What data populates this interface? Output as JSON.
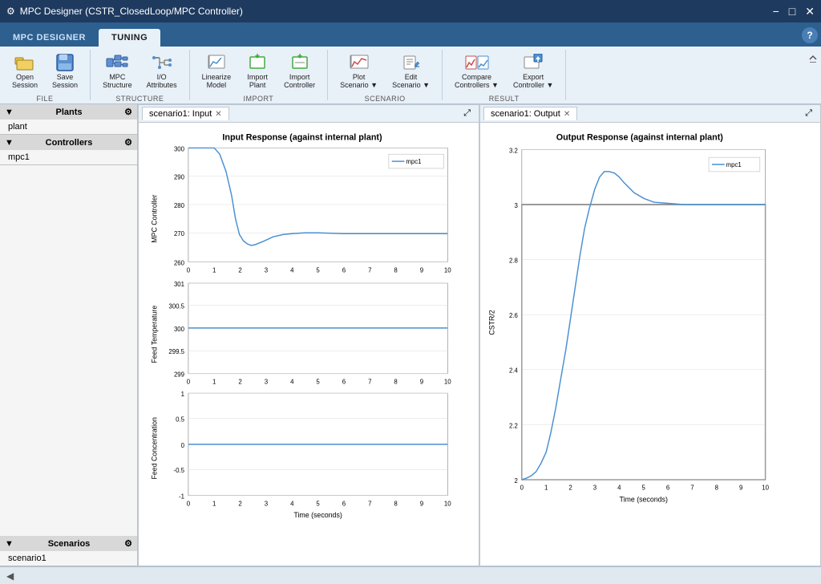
{
  "titlebar": {
    "title": "MPC Designer (CSTR_ClosedLoop/MPC Controller)",
    "icon": "⚙",
    "controls": [
      "−",
      "□",
      "✕"
    ]
  },
  "tabs": [
    {
      "id": "mpc-designer",
      "label": "MPC DESIGNER",
      "active": false
    },
    {
      "id": "tuning",
      "label": "TUNING",
      "active": true
    }
  ],
  "toolbar": {
    "groups": [
      {
        "id": "file",
        "label": "FILE",
        "items": [
          {
            "id": "open-session",
            "icon": "📂",
            "label": "Open\nSession"
          },
          {
            "id": "save-session",
            "icon": "💾",
            "label": "Save\nSession"
          }
        ]
      },
      {
        "id": "structure",
        "label": "STRUCTURE",
        "items": [
          {
            "id": "mpc-structure",
            "icon": "🔧",
            "label": "MPC\nStructure"
          },
          {
            "id": "io-attributes",
            "icon": "⚙",
            "label": "I/O\nAttributes"
          }
        ]
      },
      {
        "id": "import",
        "label": "IMPORT",
        "items": [
          {
            "id": "linearize-model",
            "icon": "📊",
            "label": "Linearize\nModel"
          },
          {
            "id": "import-plant",
            "icon": "⬇",
            "label": "Import\nPlant"
          },
          {
            "id": "import-controller",
            "icon": "⬇",
            "label": "Import\nController"
          }
        ]
      },
      {
        "id": "scenario",
        "label": "SCENARIO",
        "items": [
          {
            "id": "plot-scenario",
            "icon": "📈",
            "label": "Plot\nScenario",
            "dropdown": true
          },
          {
            "id": "edit-scenario",
            "icon": "✏",
            "label": "Edit\nScenario",
            "dropdown": true
          }
        ]
      },
      {
        "id": "result",
        "label": "RESULT",
        "items": [
          {
            "id": "compare-controllers",
            "icon": "📊",
            "label": "Compare\nControllers",
            "dropdown": true
          },
          {
            "id": "export-controller",
            "icon": "📤",
            "label": "Export\nController",
            "dropdown": true
          }
        ]
      }
    ]
  },
  "sidebar": {
    "sections": [
      {
        "id": "plants",
        "label": "Plants",
        "items": [
          "plant"
        ]
      },
      {
        "id": "controllers",
        "label": "Controllers",
        "items": [
          "mpc1"
        ]
      },
      {
        "id": "scenarios",
        "label": "Scenarios",
        "items": [
          "scenario1"
        ]
      }
    ]
  },
  "plots": {
    "left": {
      "tab_label": "scenario1: Input",
      "title": "Input Response (against internal plant)",
      "subplots": [
        {
          "ylabel": "MPC Controller",
          "ymin": 260,
          "ymax": 300,
          "yticks": [
            260,
            270,
            280,
            290,
            300
          ],
          "data_label": "mpc1"
        },
        {
          "ylabel": "Feed Temperature",
          "ymin": 299,
          "ymax": 301,
          "yticks": [
            299,
            299.5,
            300,
            300.5,
            301
          ],
          "data_label": "mpc1"
        },
        {
          "ylabel": "Feed Concentration",
          "ymin": -1,
          "ymax": 1,
          "yticks": [
            -1,
            -0.5,
            0,
            0.5,
            1
          ],
          "data_label": "mpc1"
        }
      ],
      "xlabel": "Time (seconds)",
      "xmin": 0,
      "xmax": 10
    },
    "right": {
      "tab_label": "scenario1: Output",
      "title": "Output Response (against internal plant)",
      "ylabel": "CSTR/2",
      "ymin": 2.0,
      "ymax": 3.2,
      "yticks": [
        2.0,
        2.2,
        2.4,
        2.6,
        2.8,
        3.0,
        3.2
      ],
      "xlabel": "Time (seconds)",
      "xmin": 0,
      "xmax": 10,
      "data_label": "mpc1"
    }
  },
  "statusbar": {
    "text": ""
  }
}
